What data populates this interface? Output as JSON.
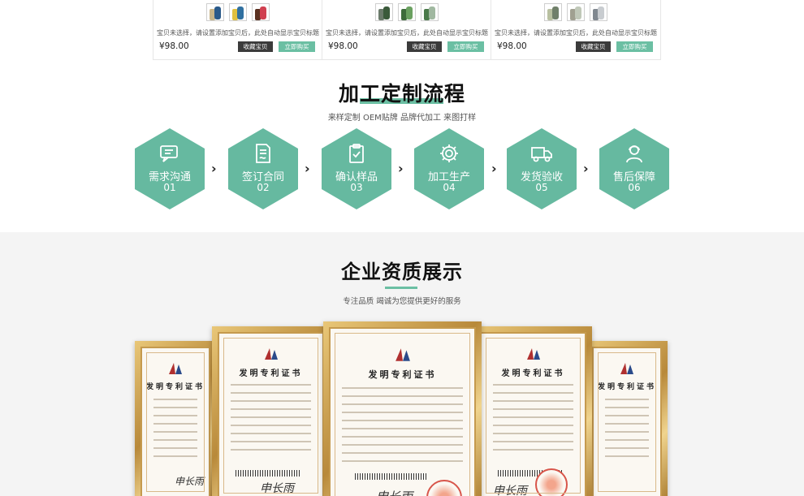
{
  "products": [
    {
      "title": "宝贝未选择，请设置添加宝贝后，此处自动显示宝贝标题",
      "price": "¥98.00",
      "fav_label": "收藏宝贝",
      "buy_label": "立即购买",
      "thumb_colors": [
        [
          "#c8b58a",
          "#2a5a8a"
        ],
        [
          "#e0c040",
          "#3070a0"
        ],
        [
          "#5a3020",
          "#d04050"
        ]
      ]
    },
    {
      "title": "宝贝未选择，请设置添加宝贝后，此处自动显示宝贝标题",
      "price": "¥98.00",
      "fav_label": "收藏宝贝",
      "buy_label": "立即购买",
      "thumb_colors": [
        [
          "#6a7a6a",
          "#3a5a3a"
        ],
        [
          "#3d6b3a",
          "#6aa060"
        ],
        [
          "#4a7a4a",
          "#a0b8a0"
        ]
      ]
    },
    {
      "title": "宝贝未选择，请设置添加宝贝后，此处自动显示宝贝标题",
      "price": "¥98.00",
      "fav_label": "收藏宝贝",
      "buy_label": "立即购买",
      "thumb_colors": [
        [
          "#b8c0a0",
          "#70806a"
        ],
        [
          "#a0a090",
          "#c0c8b8"
        ],
        [
          "#808890",
          "#c8ccd0"
        ]
      ]
    }
  ],
  "process": {
    "title": "加工定制流程",
    "subtitle": "来样定制 OEM贴牌 品牌代加工 来图打样",
    "steps": [
      {
        "label": "需求沟通",
        "num": "01",
        "icon": "chat-icon"
      },
      {
        "label": "签订合同",
        "num": "02",
        "icon": "contract-icon"
      },
      {
        "label": "确认样品",
        "num": "03",
        "icon": "clipboard-check-icon"
      },
      {
        "label": "加工生产",
        "num": "04",
        "icon": "gear-icon"
      },
      {
        "label": "发货验收",
        "num": "05",
        "icon": "truck-icon"
      },
      {
        "label": "售后保障",
        "num": "06",
        "icon": "support-agent-icon"
      }
    ],
    "arrow": "›"
  },
  "qualification": {
    "title": "企业资质展示",
    "subtitle": "专注品质 竭诚为您提供更好的服务",
    "cert_heading": "发明专利证书",
    "signature": "申长雨"
  },
  "colors": {
    "accent": "#66b9a0",
    "button_dark": "#3b3b3b",
    "frame_gold": "#c59a4e",
    "seal_red": "#d8554a"
  }
}
